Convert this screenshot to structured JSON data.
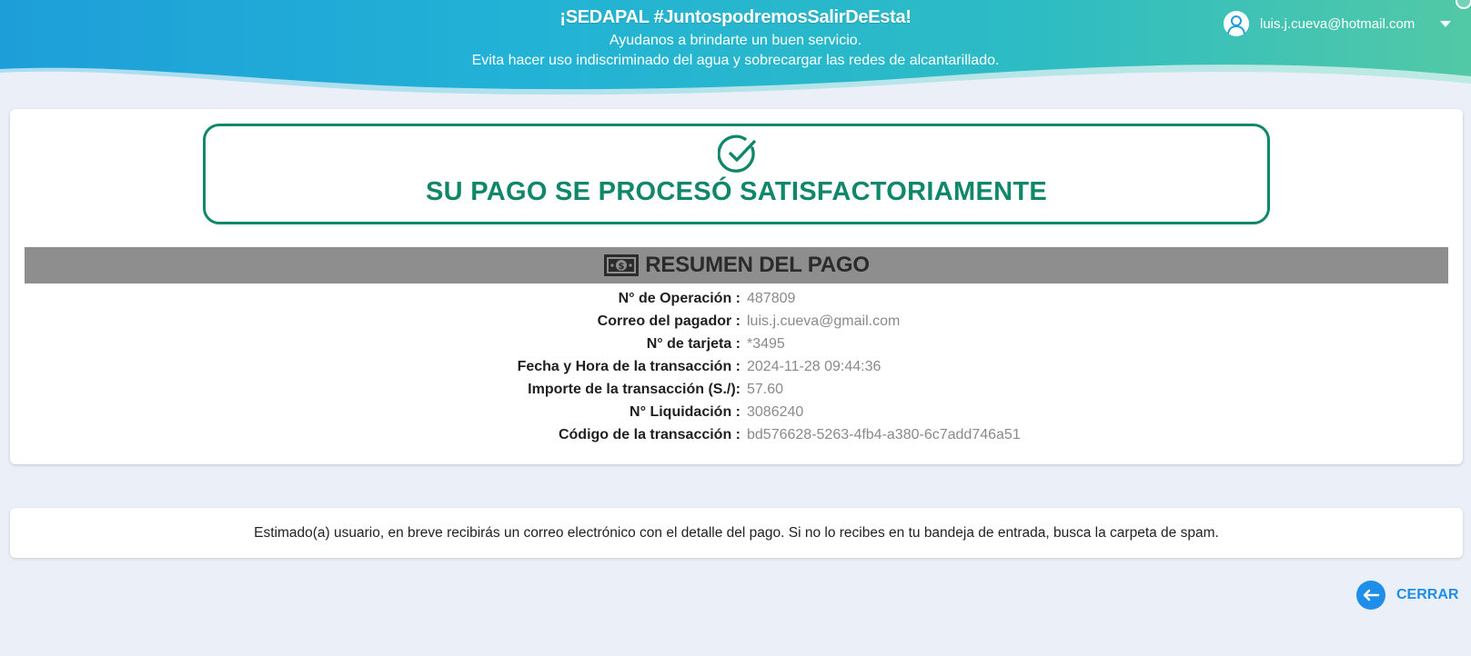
{
  "banner": {
    "title": "¡SEDAPAL #JuntospodremosSalirDeEsta!",
    "line1": "Ayudanos a brindarte un buen servicio.",
    "line2": "Evita hacer uso indiscriminado del agua y sobrecargar las redes de alcantarillado.",
    "gradient_start": "#1ea8dc",
    "gradient_end": "#3ec6a8"
  },
  "user_menu": {
    "email": "luis.j.cueva@hotmail.com",
    "avatar_icon": "user-icon",
    "dropdown_icon": "chevron-down-icon"
  },
  "success": {
    "icon": "check-circle-icon",
    "message": "SU PAGO SE PROCESÓ SATISFACTORIAMENTE",
    "color": "#10876a"
  },
  "summary": {
    "icon": "money-bill-icon",
    "title": "RESUMEN DEL PAGO",
    "rows": [
      {
        "label": "N° de Operación :",
        "value": "487809"
      },
      {
        "label": "Correo del pagador :",
        "value": "luis.j.cueva@gmail.com"
      },
      {
        "label": "N° de tarjeta :",
        "value": "*3495"
      },
      {
        "label": "Fecha y Hora de la transacción :",
        "value": "2024-11-28 09:44:36"
      },
      {
        "label": "Importe de la transacción (S./):",
        "value": "57.60"
      },
      {
        "label": "N° Liquidación :",
        "value": "3086240"
      },
      {
        "label": "Código de la transacción :",
        "value": "bd576628-5263-4fb4-a380-6c7add746a51"
      }
    ]
  },
  "notice": {
    "text": "Estimado(a) usuario, en breve recibirás un correo electrónico con el detalle del pago. Si no lo recibes en tu bandeja de entrada, busca la carpeta de spam."
  },
  "close_button": {
    "label": "CERRAR",
    "icon": "arrow-left-icon",
    "color": "#1e8ee8"
  }
}
